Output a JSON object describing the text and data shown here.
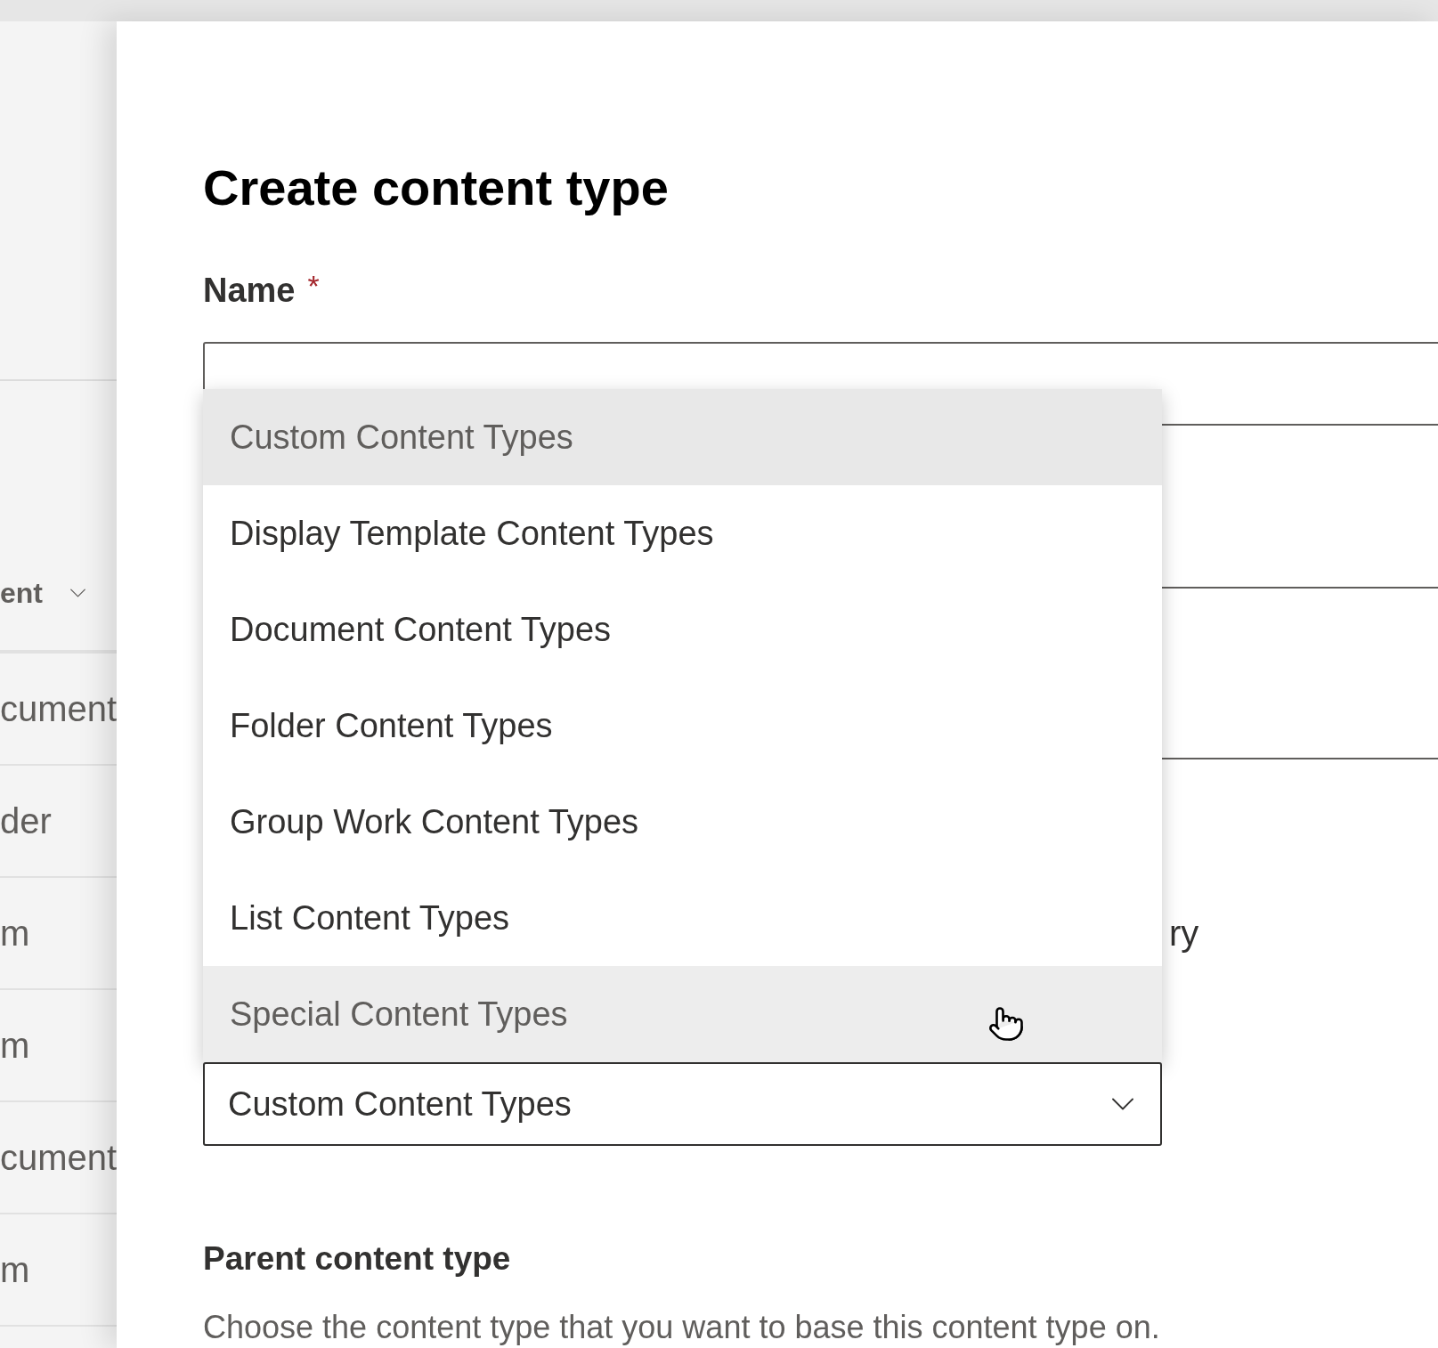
{
  "background_list": {
    "header": "ent",
    "rows": [
      "cument",
      "der",
      "m",
      "m",
      "cument",
      "m"
    ]
  },
  "panel": {
    "title": "Create content type",
    "name_label": "Name",
    "required_mark": "*",
    "partial_text": "ry",
    "dropdown_options": [
      {
        "label": "Custom Content Types",
        "selected": true,
        "hovered": false
      },
      {
        "label": "Display Template Content Types",
        "selected": false,
        "hovered": false
      },
      {
        "label": "Document Content Types",
        "selected": false,
        "hovered": false
      },
      {
        "label": "Folder Content Types",
        "selected": false,
        "hovered": false
      },
      {
        "label": "Group Work Content Types",
        "selected": false,
        "hovered": false
      },
      {
        "label": "List Content Types",
        "selected": false,
        "hovered": false
      },
      {
        "label": "Special Content Types",
        "selected": false,
        "hovered": true
      }
    ],
    "dropdown": {
      "value": "Custom Content Types"
    },
    "parent_heading": "Parent content type",
    "parent_description": "Choose the content type that you want to base this content type on."
  }
}
